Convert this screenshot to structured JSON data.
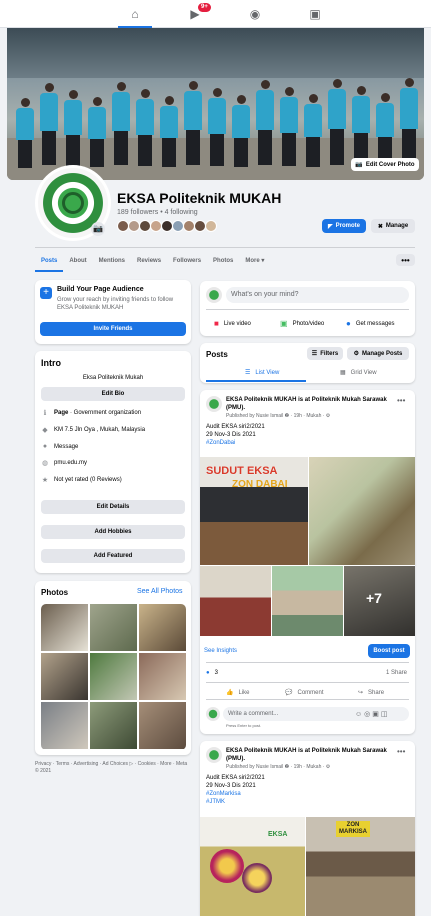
{
  "nav": {
    "notif_count": "9+"
  },
  "cover": {
    "edit_label": "Edit Cover Photo"
  },
  "profile": {
    "name": "EKSA Politeknik MUKAH",
    "stats": "189 followers • 4 following",
    "promote_label": "Promote",
    "manage_label": "Manage"
  },
  "tabs": [
    "Posts",
    "About",
    "Mentions",
    "Reviews",
    "Followers",
    "Photos",
    "More"
  ],
  "build": {
    "title": "Build Your Page Audience",
    "text": "Grow your reach by inviting friends to follow EKSA Politeknik MUKAH",
    "button": "Invite Friends"
  },
  "intro": {
    "title": "Intro",
    "bio": "Eksa Politeknik Mukah",
    "edit_bio": "Edit Bio",
    "items": [
      {
        "icon": "info-icon",
        "bold": "Page",
        "text": " · Government organization"
      },
      {
        "icon": "location-icon",
        "bold": "",
        "text": "KM 7.5 Jln Oya , Mukah, Malaysia"
      },
      {
        "icon": "messenger-icon",
        "bold": "",
        "text": "Message"
      },
      {
        "icon": "globe-icon",
        "bold": "",
        "text": "pmu.edu.my"
      },
      {
        "icon": "star-icon",
        "bold": "",
        "text": "Not yet rated (0 Reviews)"
      }
    ],
    "edit_details": "Edit Details",
    "add_hobbies": "Add Hobbies",
    "add_featured": "Add Featured"
  },
  "photos": {
    "title": "Photos",
    "see_all": "See All Photos"
  },
  "footer": "Privacy · Terms · Advertising · Ad Choices ▷ · Cookies · More · Meta © 2021",
  "composer": {
    "placeholder": "What's on your mind?",
    "live": "Live video",
    "photo": "Photo/video",
    "messages": "Get messages"
  },
  "posts": {
    "title": "Posts",
    "filters": "Filters",
    "manage": "Manage Posts",
    "list_view": "List View",
    "grid_view": "Grid View"
  },
  "post1": {
    "header": "EKSA Politeknik MUKAH is at Politeknik Mukah Sarawak (PMU).",
    "meta": "Published by Nusie Ismail ❷ · 19h · Mukah · ⚙",
    "line1": "Audit EKSA siri2/2021",
    "line2": "29 Nov-3 Dis 2021",
    "tag": "#ZonDabai",
    "banner1": "SUDUT EKSA",
    "banner2": "ZON DABAI",
    "more": "+7",
    "insights": "See Insights",
    "boost": "Boost post",
    "reactions": "3",
    "shares": "1 Share",
    "like": "Like",
    "comment": "Comment",
    "share": "Share",
    "comment_placeholder": "Write a comment...",
    "press_enter": "Press Enter to post."
  },
  "post2": {
    "header": "EKSA Politeknik MUKAH is at Politeknik Mukah Sarawak (PMU).",
    "meta": "Published by Nusie Ismail ❷ · 19h · Mukah · ⚙",
    "line1": "Audit EKSA siri2/2021",
    "line2": "29 Nov-3 Dis 2021",
    "tag1": "#ZonMarkisa",
    "tag2": "#JTMK",
    "sign1": "ZON",
    "sign2": "MARKISA",
    "eksa": "EKSA"
  }
}
